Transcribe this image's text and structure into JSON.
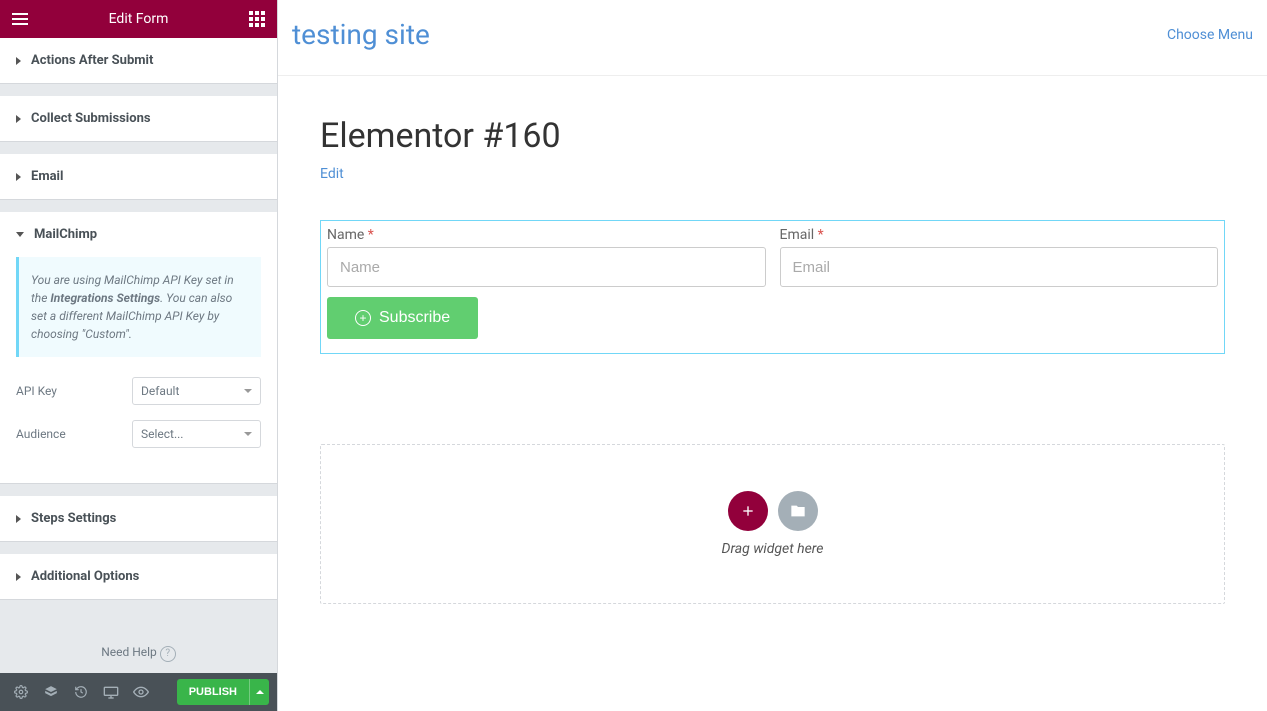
{
  "panel": {
    "title": "Edit Form",
    "sections": {
      "actions": "Actions After Submit",
      "collect": "Collect Submissions",
      "email": "Email",
      "mailchimp": "MailChimp",
      "steps": "Steps Settings",
      "additional": "Additional Options"
    },
    "mailchimp": {
      "info_pre": "You are using MailChimp API Key set in the ",
      "info_bold": "Integrations Settings",
      "info_post": ". You can also set a different MailChimp API Key by choosing \"Custom\".",
      "api_key_label": "API Key",
      "api_key_value": "Default",
      "audience_label": "Audience",
      "audience_value": "Select..."
    },
    "help": "Need Help",
    "publish": "PUBLISH"
  },
  "canvas": {
    "site_title": "testing site",
    "choose_menu": "Choose Menu",
    "page_title": "Elementor #160",
    "edit": "Edit",
    "form": {
      "name_label": "Name",
      "name_placeholder": "Name",
      "email_label": "Email",
      "email_placeholder": "Email",
      "submit": "Subscribe"
    },
    "drop_text": "Drag widget here"
  }
}
